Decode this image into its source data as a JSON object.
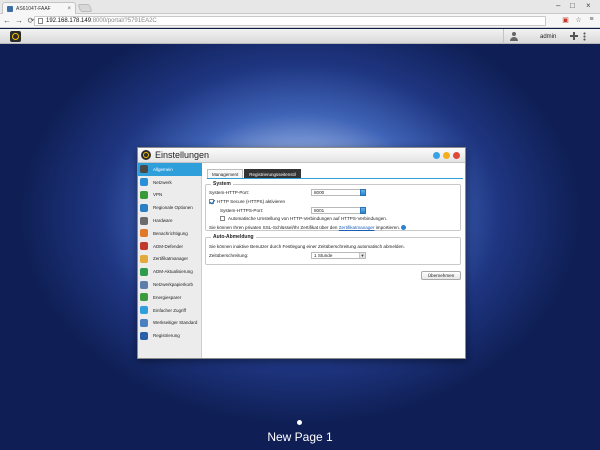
{
  "browser": {
    "tab_title": "AS6104T-FAAF",
    "tab_close": "×",
    "url_host": "192.168.178.149",
    "url_rest": ":8000/portal/?5791EA2C",
    "back": "←",
    "forward": "→",
    "reload": "⟳",
    "minimize": "–",
    "maximize": "□",
    "close": "×",
    "menu": "≡",
    "star": "☆"
  },
  "topbar": {
    "username": "admin"
  },
  "window": {
    "title": "Einstellungen"
  },
  "nav": {
    "items": [
      {
        "label": "Allgemein",
        "color": "#4a4a4a"
      },
      {
        "label": "Netzwerk",
        "color": "#2a8fd6"
      },
      {
        "label": "VPN",
        "color": "#3a9a3a"
      },
      {
        "label": "Regionale Optionen",
        "color": "#2b7fc4"
      },
      {
        "label": "Hardware",
        "color": "#6b6b6b"
      },
      {
        "label": "Benachrichtigung",
        "color": "#e07a2a"
      },
      {
        "label": "ADM-Defender",
        "color": "#c0392b"
      },
      {
        "label": "Zertifikatmanager",
        "color": "#e2a93b"
      },
      {
        "label": "ADM-Aktualisierung",
        "color": "#2e9c4a"
      },
      {
        "label": "Netzwerkpapierkorb",
        "color": "#5d7ea8"
      },
      {
        "label": "Energiesparer",
        "color": "#3d9b3d"
      },
      {
        "label": "Einfacher Zugriff",
        "color": "#2f9fdc"
      },
      {
        "label": "Werkseitiger Standard",
        "color": "#4a7fc0"
      },
      {
        "label": "Registrierung",
        "color": "#2b5ea8"
      }
    ]
  },
  "tabs": [
    "Management",
    "Registrierungsseitenstil"
  ],
  "system": {
    "legend": "System",
    "http_port_label": "System-HTTP-Port:",
    "http_port_value": "8000",
    "https_checkbox_label": "HTTP Secure (HTTPS) aktivieren",
    "https_port_label": "System-HTTPS-Port:",
    "https_port_value": "8001",
    "redirect_label": "Automatische Umstellung von HTTP-Verbindungen auf HTTPS-Verbindungen.",
    "cert_text_before": "Sie können Ihren privaten SSL-Schlüssel/Ihr Zertifikat über den",
    "cert_link": "Zertifikatmanager",
    "cert_text_after": "importieren."
  },
  "logout": {
    "legend": "Auto-Abmeldung",
    "description": "Sie können inaktive Benutzer durch Festlegung einer Zeitüberschreitung automatisch abmelden.",
    "timeout_label": "Zeitüberschreitung:",
    "timeout_value": "1 Stunde"
  },
  "apply_button": "Übernehmen",
  "desktop": {
    "page_label": "New Page 1"
  }
}
